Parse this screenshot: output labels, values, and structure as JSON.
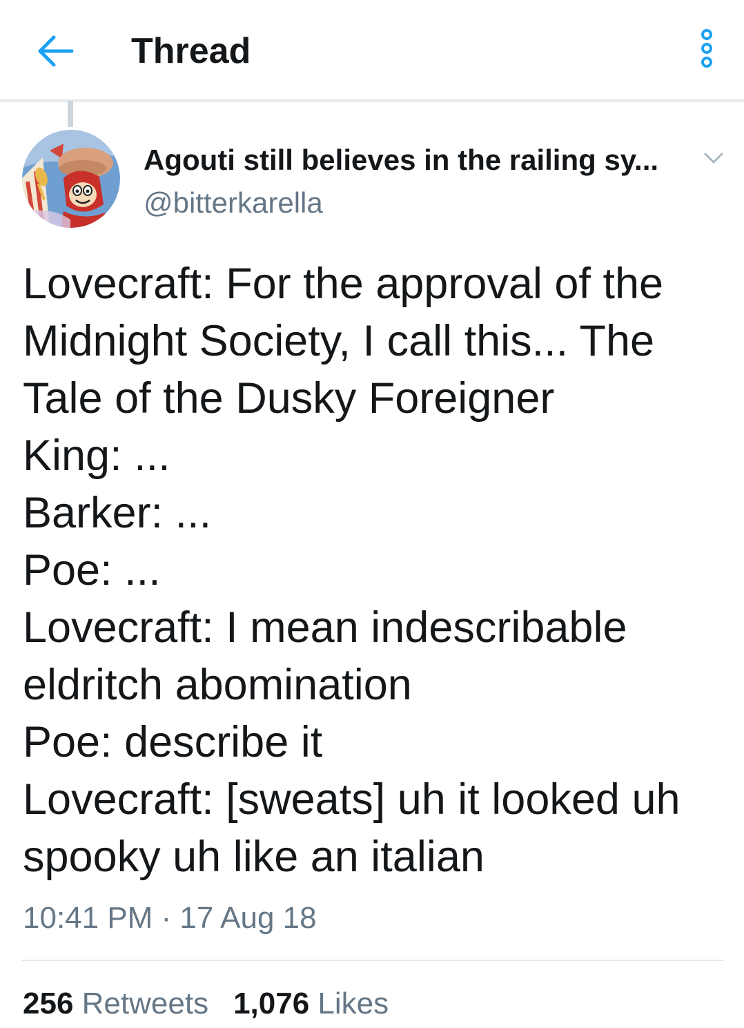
{
  "header": {
    "title": "Thread",
    "back_icon": "arrow-left-icon",
    "more_icon": "more-vertical-icon",
    "accent_color": "#1da1f2"
  },
  "tweet": {
    "display_name": "Agouti still believes in the railing sy...",
    "handle": "@bitterkarella",
    "avatar_icon": "avatar-cartoon-image",
    "caret_icon": "chevron-down-icon",
    "text_lines": [
      "Lovecraft: For the approval of the",
      "Midnight Society, I call this... The",
      "Tale of the Dusky Foreigner",
      "King: ...",
      "Barker: ...",
      "Poe: ...",
      "Lovecraft: I mean indescribable",
      "eldritch abomination",
      "Poe: describe it",
      "Lovecraft: [sweats] uh it looked uh",
      "spooky uh like an italian"
    ],
    "timestamp": "10:41 PM · 17 Aug 18",
    "stats": {
      "retweets_count": "256",
      "retweets_label": "Retweets",
      "likes_count": "1,076",
      "likes_label": "Likes"
    }
  }
}
